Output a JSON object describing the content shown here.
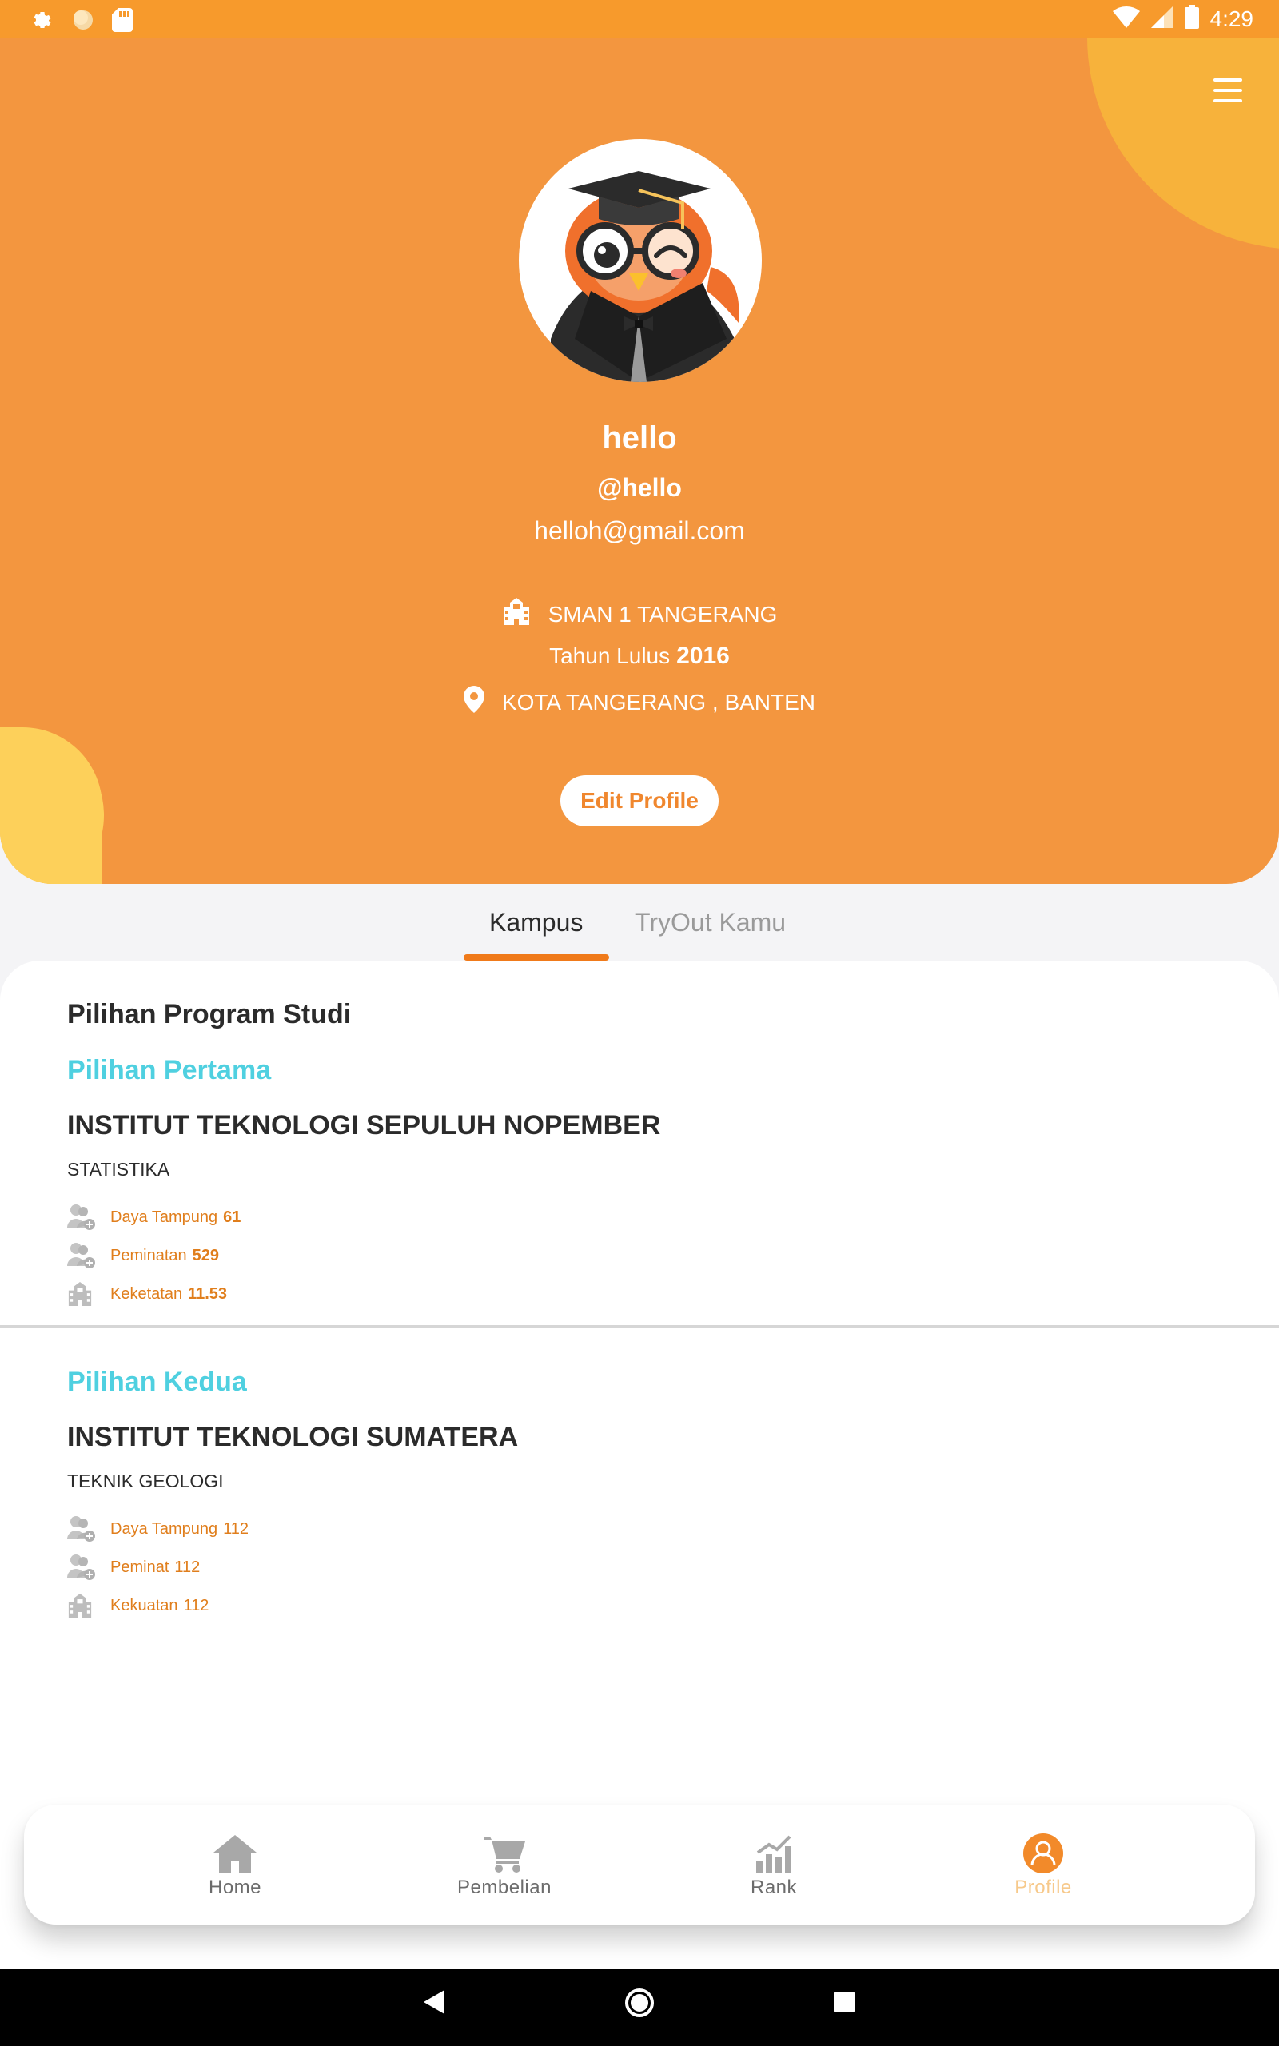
{
  "status_bar": {
    "time": "4:29"
  },
  "profile": {
    "name": "hello",
    "username": "@hello",
    "email": "helloh@gmail.com",
    "school": "SMAN 1 TANGERANG",
    "year_prefix": "Tahun Lulus",
    "year": "2016",
    "location": "KOTA TANGERANG , BANTEN",
    "edit_label": "Edit Profile"
  },
  "tabs": [
    {
      "label": "Kampus",
      "active": true
    },
    {
      "label": "TryOut Kamu",
      "active": false
    }
  ],
  "program": {
    "title": "Pilihan Program Studi",
    "choices": [
      {
        "label": "Pilihan Pertama",
        "campus": "INSTITUT TEKNOLOGI SEPULUH NOPEMBER",
        "program": "STATISTIKA",
        "stats": [
          {
            "icon": "users-plus-icon",
            "label": "Daya Tampung",
            "value": "61"
          },
          {
            "icon": "users-plus-icon",
            "label": "Peminatan",
            "value": "529"
          },
          {
            "icon": "school-building-icon",
            "label": "Keketatan",
            "value": "11.53"
          }
        ]
      },
      {
        "label": "Pilihan Kedua",
        "campus": "INSTITUT TEKNOLOGI SUMATERA",
        "program": "TEKNIK GEOLOGI",
        "stats": [
          {
            "icon": "users-plus-icon",
            "label": "Daya Tampung",
            "value": "112"
          },
          {
            "icon": "users-plus-icon",
            "label": "Peminat",
            "value": "112"
          },
          {
            "icon": "school-building-icon",
            "label": "Kekuatan",
            "value": "112"
          }
        ]
      }
    ]
  },
  "bottom_nav": [
    {
      "label": "Home",
      "icon": "home-icon"
    },
    {
      "label": "Pembelian",
      "icon": "cart-icon"
    },
    {
      "label": "Rank",
      "icon": "rank-chart-icon"
    },
    {
      "label": "Profile",
      "icon": "profile-icon",
      "active": true
    }
  ],
  "colors": {
    "header": "#f3963f",
    "status_bar": "#f79a2c",
    "accent_orange": "#f07a1a",
    "choice_label": "#4fd0e0",
    "stat_text": "#e07e1c"
  }
}
